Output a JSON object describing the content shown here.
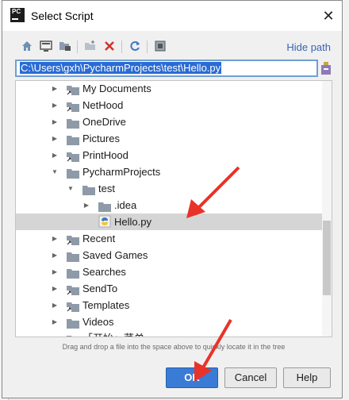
{
  "dialog": {
    "title": "Select Script",
    "app_icon_text": "PC",
    "close_glyph": "✕"
  },
  "toolbar": {
    "icons": [
      "home-icon",
      "desktop-icon",
      "project-icon",
      "new-folder-icon",
      "delete-icon",
      "refresh-icon",
      "show-hidden-icon"
    ],
    "hide_path_label": "Hide path"
  },
  "path": {
    "value": "C:\\Users\\gxh\\PycharmProjects\\test\\Hello.py"
  },
  "tree": {
    "items": [
      {
        "label": "My Documents",
        "type": "link-folder",
        "arrow": "▶"
      },
      {
        "label": "NetHood",
        "type": "link-folder",
        "arrow": "▶"
      },
      {
        "label": "OneDrive",
        "type": "folder",
        "arrow": "▶"
      },
      {
        "label": "Pictures",
        "type": "folder",
        "arrow": "▶"
      },
      {
        "label": "PrintHood",
        "type": "link-folder",
        "arrow": "▶"
      },
      {
        "label": "PycharmProjects",
        "type": "folder",
        "arrow": "▼"
      },
      {
        "label": "test",
        "type": "folder",
        "arrow": "▼"
      },
      {
        "label": ".idea",
        "type": "folder",
        "arrow": "▶"
      },
      {
        "label": "Hello.py",
        "type": "python-file",
        "arrow": ""
      },
      {
        "label": "Recent",
        "type": "link-folder",
        "arrow": "▶"
      },
      {
        "label": "Saved Games",
        "type": "folder",
        "arrow": "▶"
      },
      {
        "label": "Searches",
        "type": "folder",
        "arrow": "▶"
      },
      {
        "label": "SendTo",
        "type": "link-folder",
        "arrow": "▶"
      },
      {
        "label": "Templates",
        "type": "link-folder",
        "arrow": "▶"
      },
      {
        "label": "Videos",
        "type": "folder",
        "arrow": "▶"
      },
      {
        "label": "「开始」菜单",
        "type": "link-folder",
        "arrow": "▶"
      }
    ],
    "selected": "Hello.py"
  },
  "hint": "Drag and drop a file into the space above to quickly locate it in the tree",
  "buttons": {
    "ok": "OK",
    "cancel": "Cancel",
    "help": "Help"
  },
  "colors": {
    "accent": "#3a7bd5",
    "annotation_arrow": "#e8332a",
    "selection": "#d5d5d5"
  }
}
